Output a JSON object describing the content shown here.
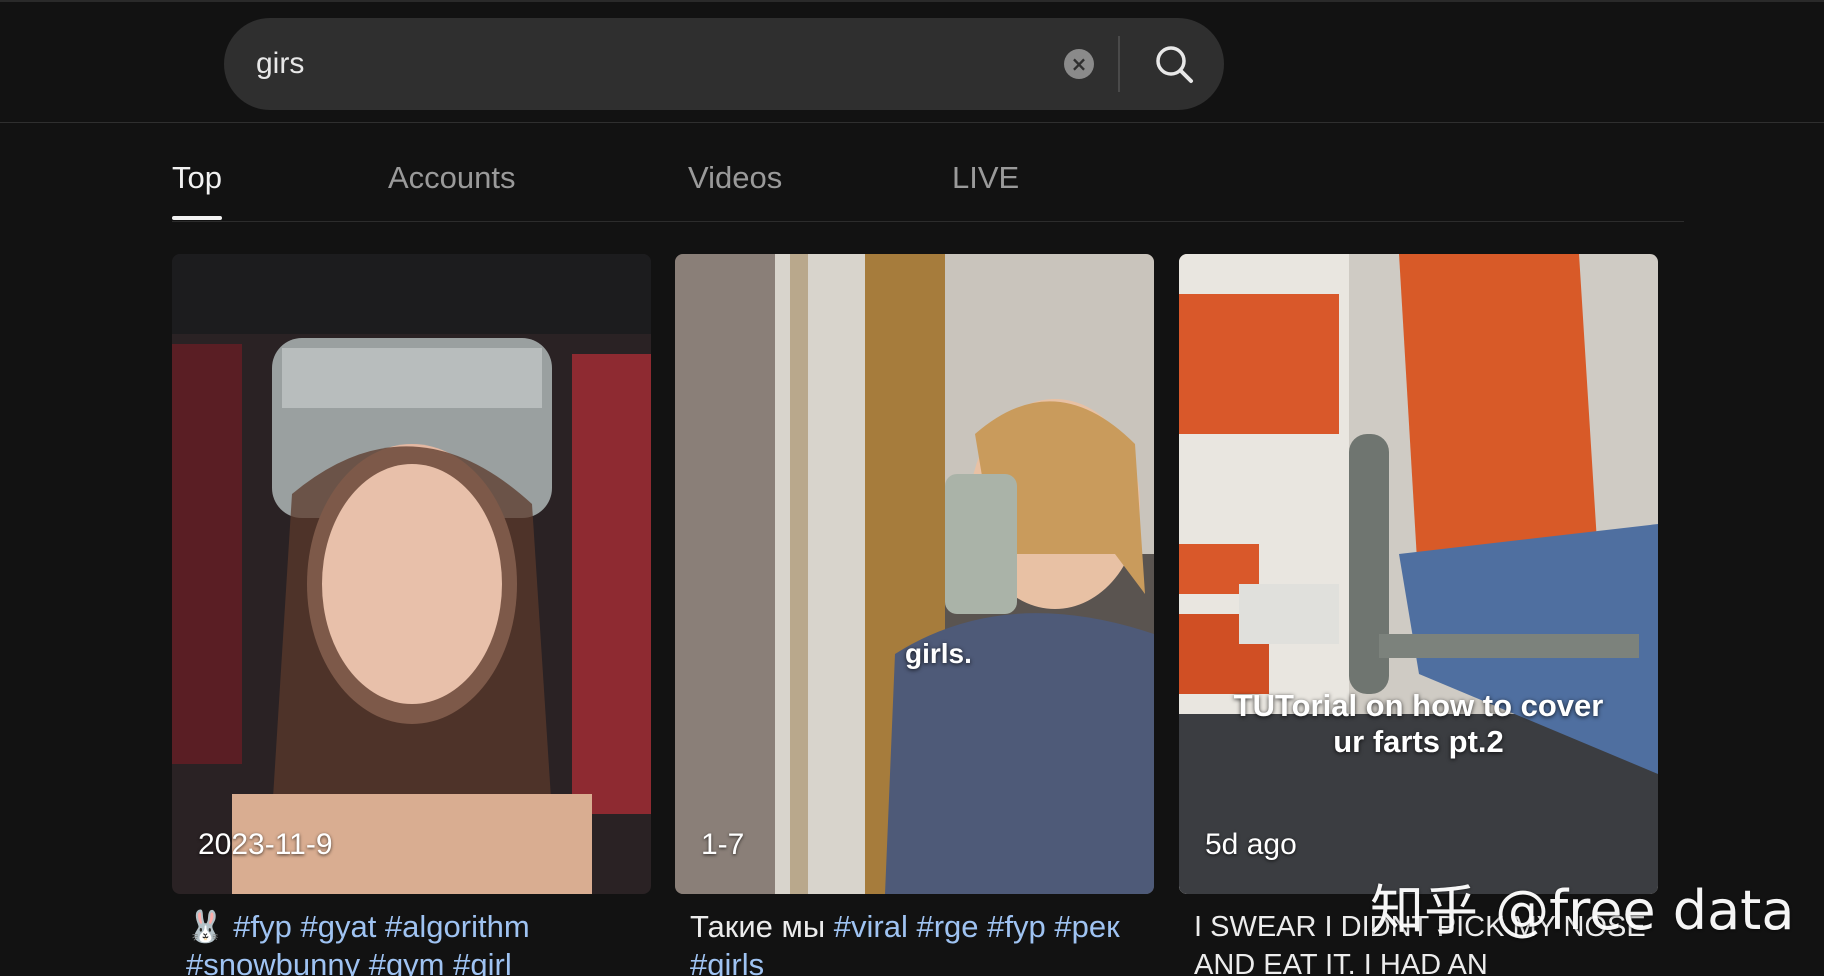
{
  "search": {
    "query": "girs"
  },
  "tabs": [
    {
      "label": "Top",
      "active": true
    },
    {
      "label": "Accounts",
      "active": false
    },
    {
      "label": "Videos",
      "active": false
    },
    {
      "label": "LIVE",
      "active": false
    }
  ],
  "videos": [
    {
      "date": "2023-11-9",
      "caption_prefix": "🐰",
      "tags": [
        "#fyp",
        "#gyat",
        "#algorithm",
        "#snowbunny",
        "#gym",
        "#girl"
      ]
    },
    {
      "date": "1-7",
      "overlay": "girls.",
      "caption_prefix": "Такие мы",
      "tags": [
        "#viral",
        "#rge",
        "#fyp",
        "#рек",
        "#girls"
      ]
    },
    {
      "date": "5d ago",
      "overlay_line1": "TUTorial on how to cover",
      "overlay_line2": "ur farts pt.2",
      "caption": "I SWEAR I DIDNT PICK MY NOSE AND EAT IT. I HAD AN"
    }
  ],
  "watermark": "知乎 @free data",
  "icons": [
    "clear-icon",
    "search-icon"
  ],
  "colors": {
    "background": "#121212",
    "search_bg": "#2f2f2f",
    "hashtag": "#9fc3f2",
    "tab_inactive": "#9a9a9a",
    "tab_active": "#f2f2f2"
  }
}
